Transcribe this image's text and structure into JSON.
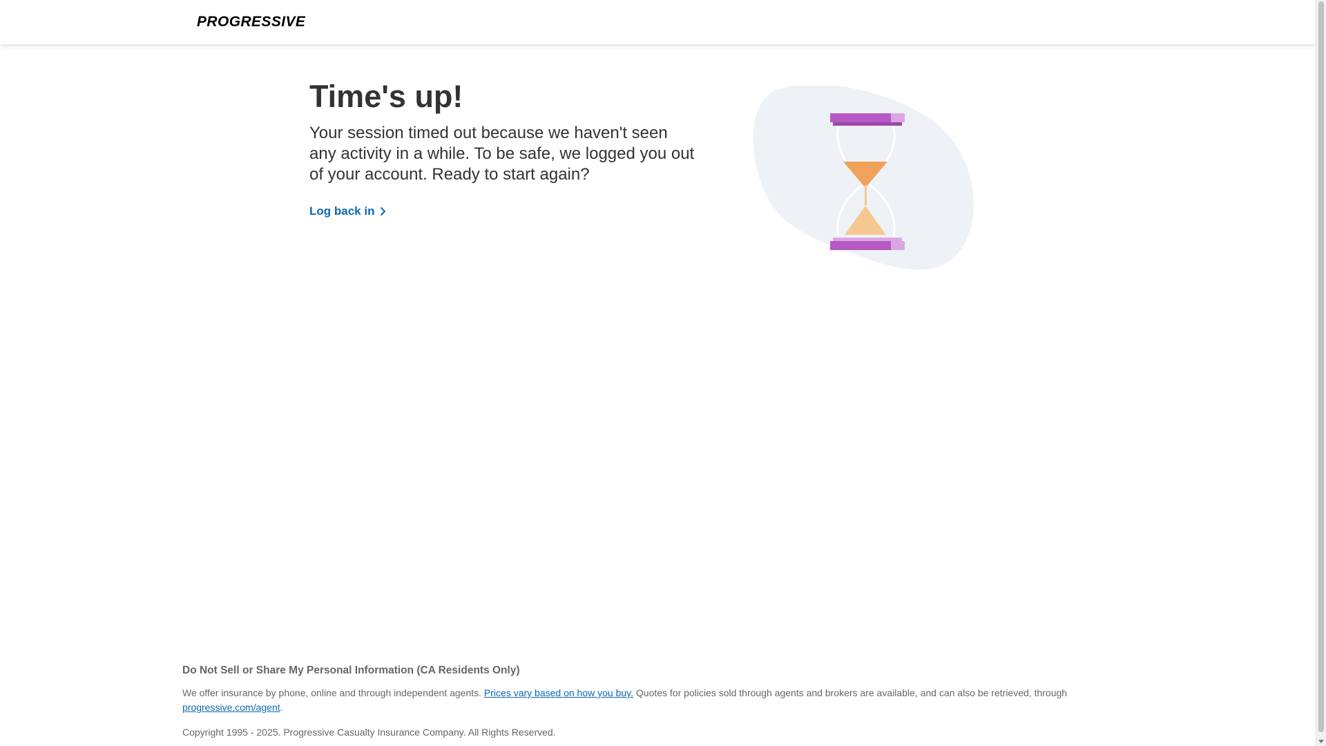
{
  "header": {
    "logo_text": "PROGRESSIVE",
    "logo_color": "#1f5ea8"
  },
  "main": {
    "title": "Time's up!",
    "message": "Your session timed out because we haven't seen any activity in a while. To be safe, we logged you out of your account. Ready to start again?",
    "action_label": "Log back in",
    "action_icon": "arrow-right-icon",
    "link_color": "#0b69b0"
  },
  "illustration": {
    "name": "hourglass-icon",
    "blob_color": "#eef2f6",
    "cap_color": "#b659c4",
    "cap_light_color": "#d9a6e1",
    "sand_top_color": "#f0a25b",
    "sand_bottom_color": "#f6c890"
  },
  "footer": {
    "heading": "Do Not Sell or Share My Personal Information (CA Residents Only)",
    "text_before": "We offer insurance by phone, online and through independent agents.",
    "prices_link": "Prices vary based on how you buy.",
    "text_after": "Quotes for policies sold through agents and brokers are available, and can also be retrieved, through",
    "agent_link": "progressive.com/agent",
    "period": ".",
    "copyright": "Copyright 1995 - 2025. Progressive Casualty Insurance Company. All Rights Reserved."
  }
}
